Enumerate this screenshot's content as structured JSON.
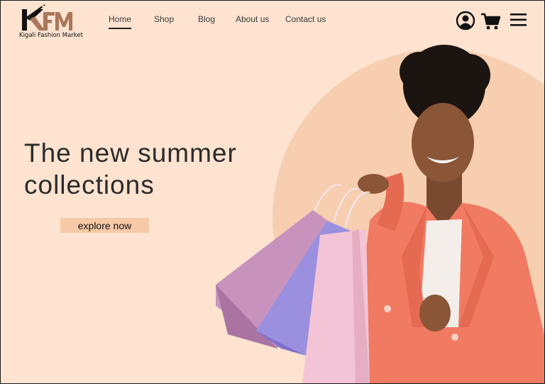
{
  "brand": {
    "logo_letters": "KFM",
    "name": "Kigali Fashion Market"
  },
  "nav": {
    "items": [
      {
        "label": "Home",
        "active": true
      },
      {
        "label": "Shop",
        "active": false
      },
      {
        "label": "Blog",
        "active": false
      },
      {
        "label": "About us",
        "active": false
      },
      {
        "label": "Contact us",
        "active": false
      }
    ]
  },
  "header_icons": [
    "user-account-icon",
    "shopping-cart-icon",
    "hamburger-menu-icon"
  ],
  "hero": {
    "title_line1": "The new summer",
    "title_line2": "collections",
    "cta_label": "explore now"
  },
  "colors": {
    "background": "#fde3d0",
    "cta_background": "#f7c9a6",
    "circle": "#f7cfb0",
    "jacket": "#f07a62",
    "logo_brown": "#a9775a"
  }
}
